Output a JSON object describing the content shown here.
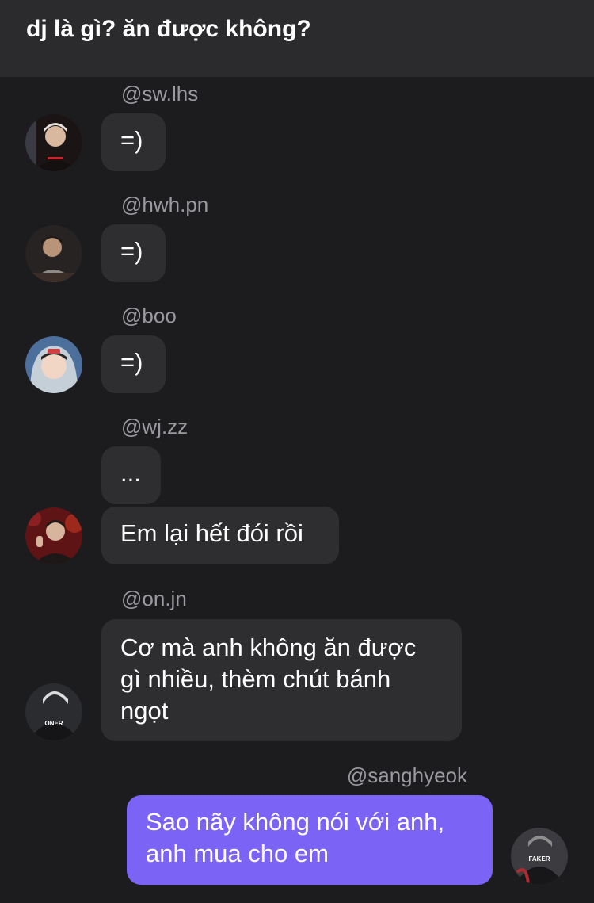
{
  "header": {
    "title": "dj là gì? ăn được không?"
  },
  "messages": [
    {
      "username": "@sw.lhs",
      "texts": [
        "=)"
      ]
    },
    {
      "username": "@hwh.pn",
      "texts": [
        "=)"
      ]
    },
    {
      "username": "@boo",
      "texts": [
        "=)"
      ]
    },
    {
      "username": "@wj.zz",
      "texts": [
        "...",
        "Em lại hết đói rồi"
      ]
    },
    {
      "username": "@on.jn",
      "texts": [
        "Cơ mà anh không ăn được gì nhiều, thèm chút bánh ngọt"
      ],
      "avatar_jersey": "ONER"
    },
    {
      "username": "@sanghyeok",
      "texts": [
        "Sao nãy không nói với anh, anh mua cho em"
      ],
      "avatar_jersey": "FAKER"
    }
  ],
  "colors": {
    "background": "#1c1c1e",
    "header": "#2b2b2d",
    "bubble": "#2e2e31",
    "own_bubble": "#7b63f6",
    "username": "#9a9aa0"
  }
}
